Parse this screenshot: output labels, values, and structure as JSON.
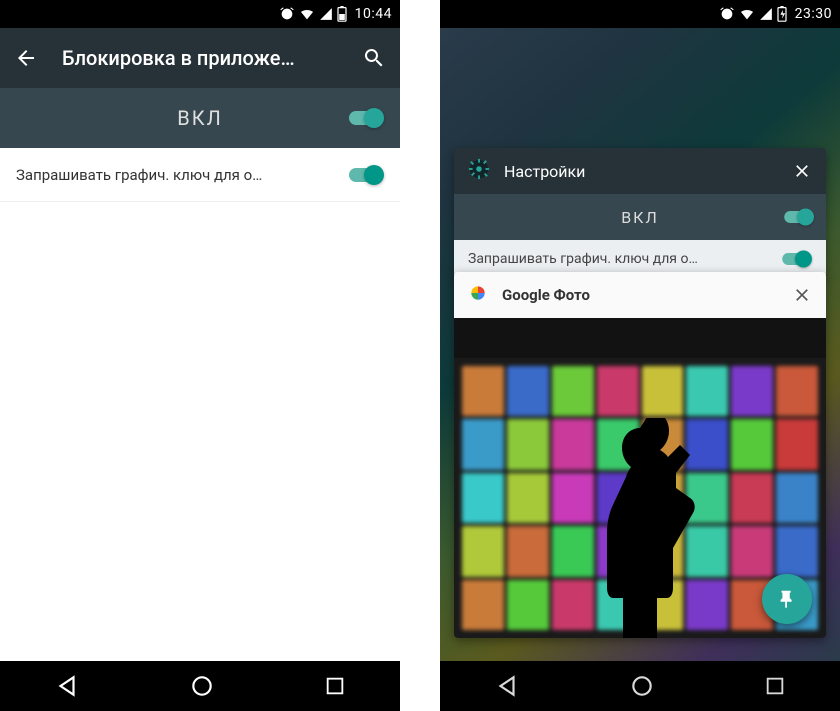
{
  "left": {
    "status": {
      "time": "10:44"
    },
    "appbar": {
      "title": "Блокировка в приложе…"
    },
    "enable": {
      "label": "ВКЛ",
      "on": true
    },
    "setting": {
      "label": "Запрашивать графич. ключ для о…",
      "on": true
    }
  },
  "right": {
    "status": {
      "time": "23:30"
    },
    "recents": {
      "settings_card": {
        "title": "Настройки",
        "enable_label": "ВКЛ",
        "setting_label": "Запрашивать графич. ключ для о…"
      },
      "photos_card": {
        "title": "Google Фото"
      }
    }
  },
  "colors": {
    "teal": "#009688",
    "dark_header": "#263238",
    "dark_sub": "#37474F"
  },
  "tile_colors": [
    "#c97b3a",
    "#3a6bc9",
    "#6bc93a",
    "#c93a6b",
    "#c9c03a",
    "#3ac9b0",
    "#7a3ac9",
    "#c9593a",
    "#3a9bc9",
    "#8bc93a",
    "#c93a9b",
    "#3ac96b",
    "#c98a3a",
    "#3a4fc9",
    "#55c93a",
    "#c93a3a",
    "#3ac9c9",
    "#a6c93a",
    "#c93ab9",
    "#5e3ac9",
    "#c9a23a",
    "#3ac98b",
    "#c93a55",
    "#3a83c9",
    "#b0c93a",
    "#c96b3a",
    "#3ac955",
    "#8b3ac9",
    "#c9b63a",
    "#3ac9a6",
    "#c93a79",
    "#3a6bc9",
    "#c97b3a",
    "#55c93a",
    "#c93a6b",
    "#3ac9b0",
    "#c9c03a",
    "#7a3ac9",
    "#c9593a",
    "#3a9bc9"
  ]
}
